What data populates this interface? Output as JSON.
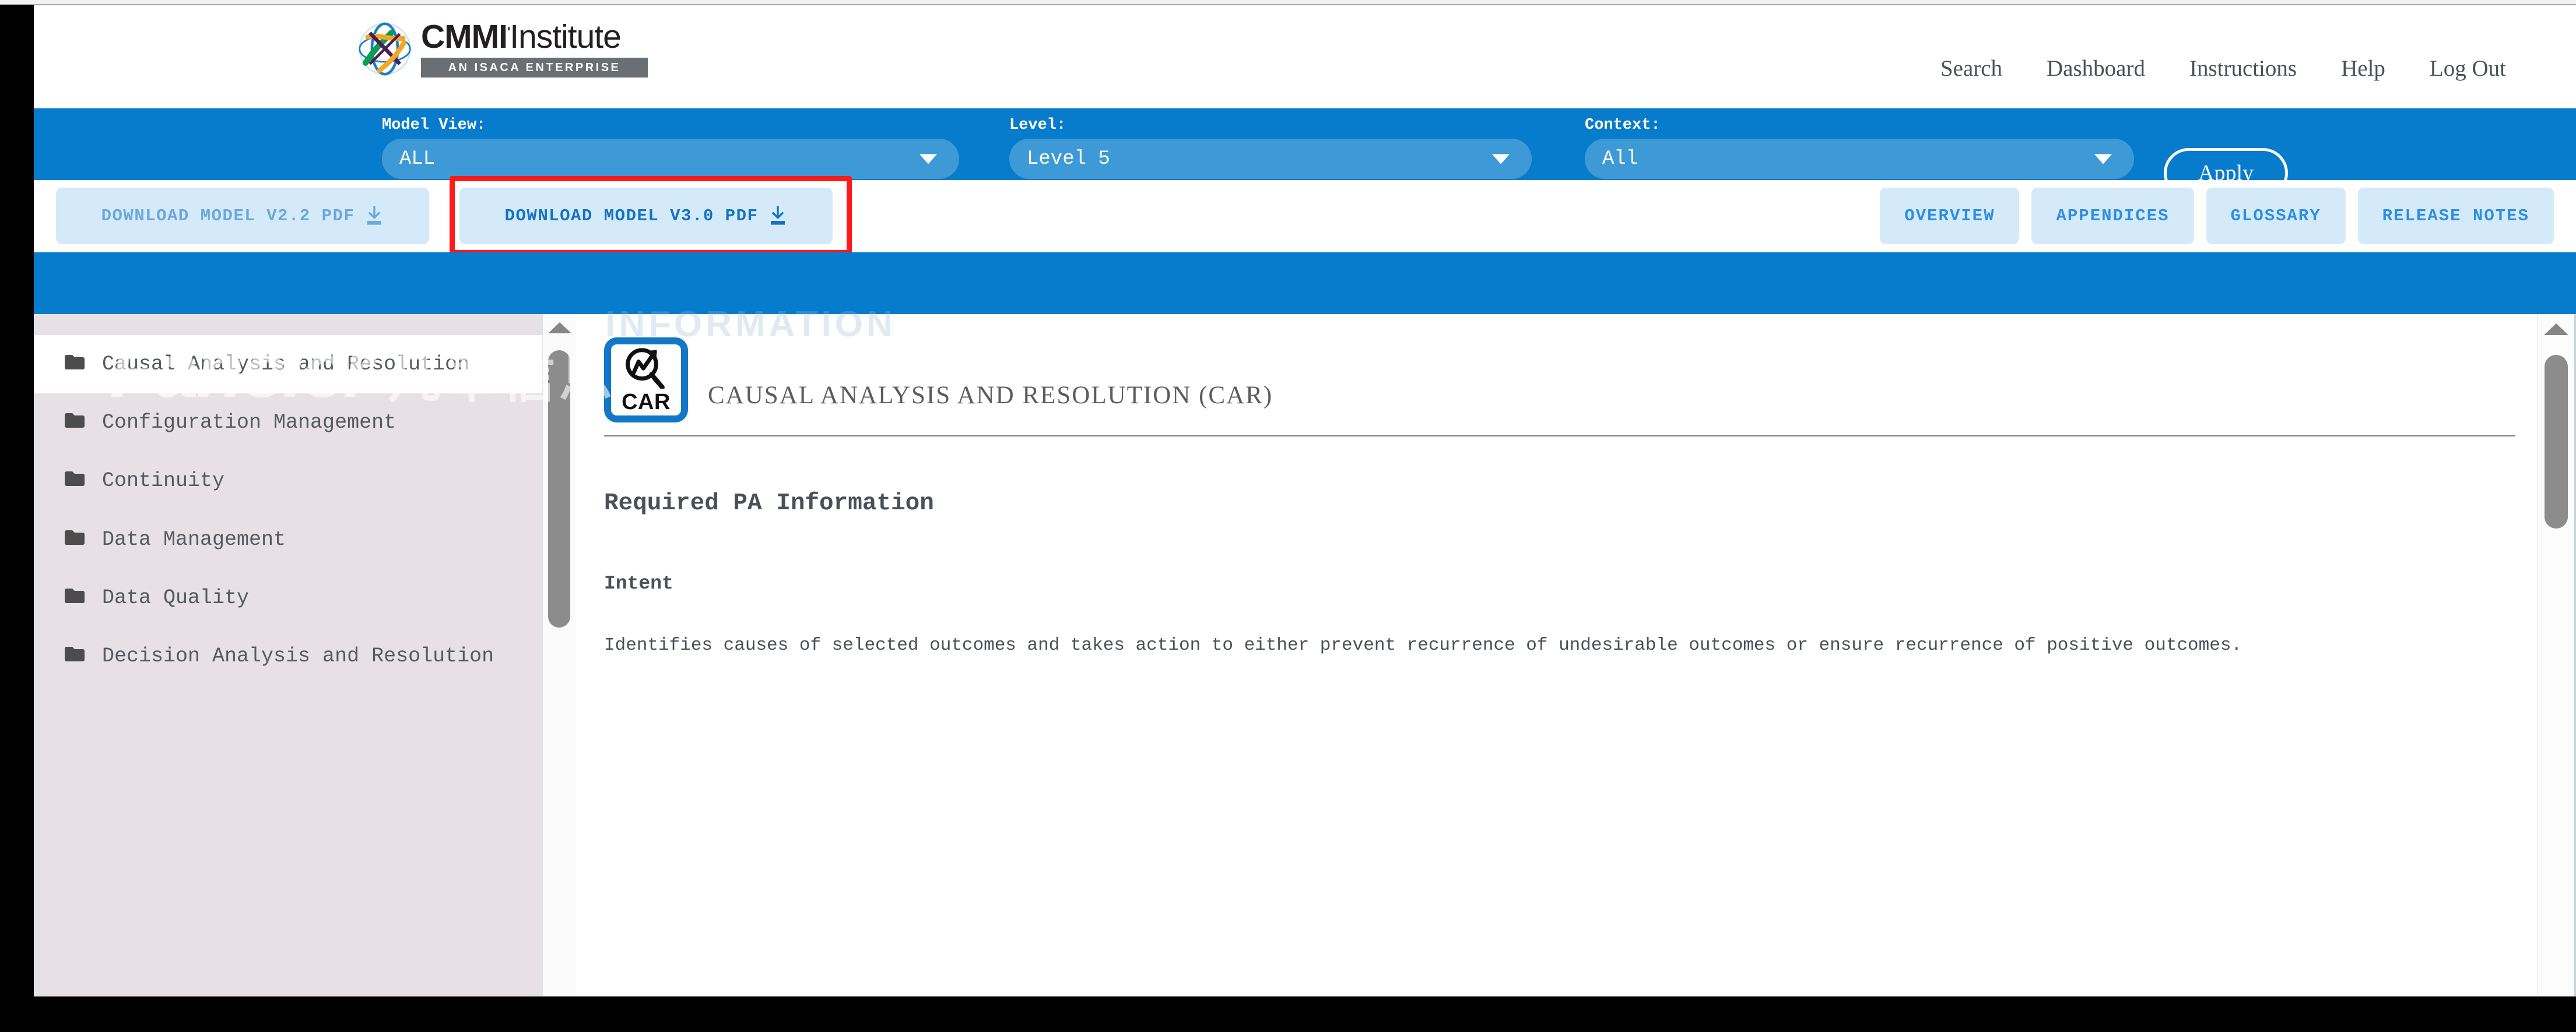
{
  "brand": {
    "name_bold": "CMMI",
    "name_light": "Institute",
    "tagline": "AN ISACA ENTERPRISE",
    "logo_icon": "globe-weave-icon"
  },
  "topnav": {
    "items": [
      {
        "label": "Search",
        "name": "nav-search"
      },
      {
        "label": "Dashboard",
        "name": "nav-dashboard"
      },
      {
        "label": "Instructions",
        "name": "nav-instructions"
      },
      {
        "label": "Help",
        "name": "nav-help"
      },
      {
        "label": "Log Out",
        "name": "nav-logout"
      }
    ]
  },
  "filters": {
    "model_view": {
      "label": "Model View:",
      "value": "ALL"
    },
    "level": {
      "label": "Level:",
      "value": "Level 5"
    },
    "context": {
      "label": "Context:",
      "value": "All"
    },
    "apply_label": "Apply",
    "bar_color": "#077BCC",
    "select_color": "#3D9AD6"
  },
  "actions": {
    "download_v22": "DOWNLOAD MODEL V2.2 PDF",
    "download_v30": "DOWNLOAD MODEL V3.0 PDF",
    "highlight_color": "#FF1A1A",
    "tabs": [
      {
        "label": "OVERVIEW",
        "name": "tab-overview"
      },
      {
        "label": "APPENDICES",
        "name": "tab-appendices"
      },
      {
        "label": "GLOSSARY",
        "name": "tab-glossary"
      },
      {
        "label": "RELEASE NOTES",
        "name": "tab-release-notes"
      }
    ]
  },
  "sidebar": {
    "items": [
      {
        "label": "Causal Analysis and Resolution",
        "active": true
      },
      {
        "label": "Configuration Management",
        "active": false
      },
      {
        "label": "Continuity",
        "active": false
      },
      {
        "label": "Data Management",
        "active": false
      },
      {
        "label": "Data Quality",
        "active": false
      },
      {
        "label": "Decision Analysis and Resolution",
        "active": false
      }
    ]
  },
  "main": {
    "badge_abbr": "CAR",
    "badge_icon": "magnifier-growth-arrow-icon",
    "pa_title": "CAUSAL ANALYSIS AND RESOLUTION (CAR)",
    "section_heading": "Required PA Information",
    "subsection_heading": "Intent",
    "intent_text": "Identifies causes of selected outcomes and takes action to either prevent recurrence of undesirable outcomes or ensure recurrence of positive outcomes."
  },
  "watermark": {
    "en": "Fancier",
    "cn": "凡奉信息",
    "ghost": "INFORMATION"
  }
}
